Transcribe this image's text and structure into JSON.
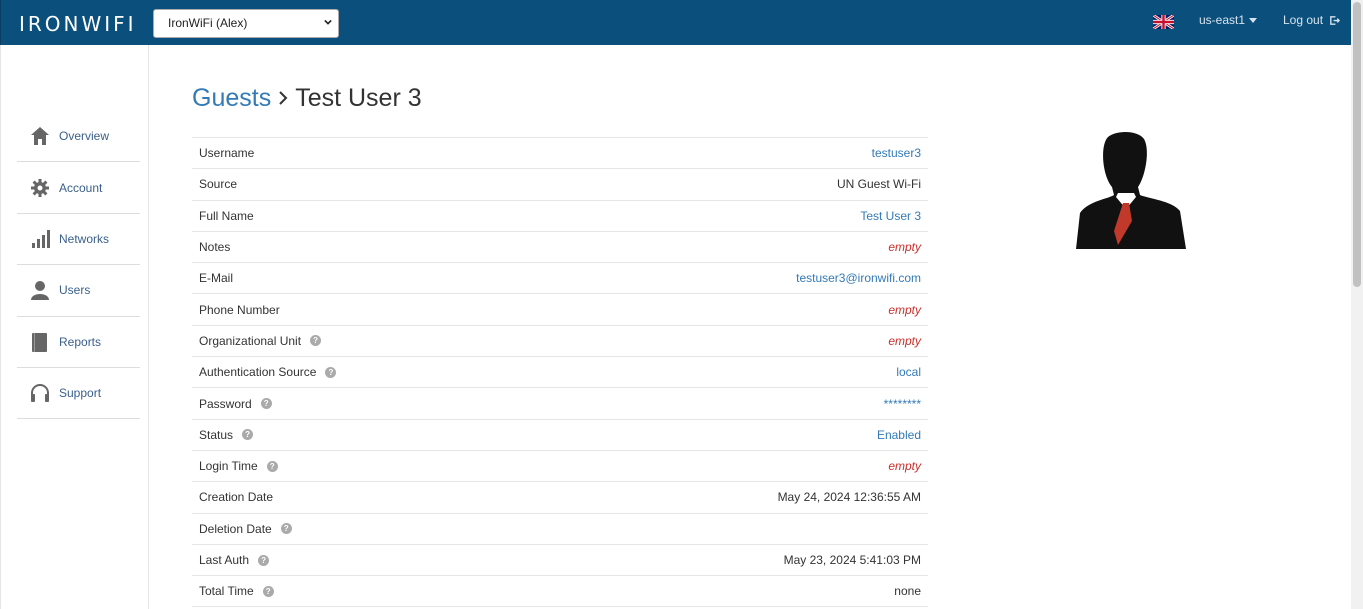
{
  "header": {
    "logo": "IRONWIFI",
    "account_select": "IronWiFi (Alex)",
    "region": "us-east1",
    "logout": "Log out",
    "flag_icon": "uk-flag-icon"
  },
  "sidebar": {
    "items": [
      {
        "label": "Overview",
        "icon": "home-icon"
      },
      {
        "label": "Account",
        "icon": "gear-icon"
      },
      {
        "label": "Networks",
        "icon": "signal-bars-icon"
      },
      {
        "label": "Users",
        "icon": "user-icon"
      },
      {
        "label": "Reports",
        "icon": "book-icon"
      },
      {
        "label": "Support",
        "icon": "headset-icon"
      }
    ]
  },
  "breadcrumb": {
    "parent": "Guests",
    "current": "Test User 3"
  },
  "properties": [
    {
      "label": "Username",
      "value": "testuser3",
      "style": "link",
      "help": false
    },
    {
      "label": "Source",
      "value": "UN Guest Wi-Fi",
      "style": "plain",
      "help": false
    },
    {
      "label": "Full Name",
      "value": "Test User 3",
      "style": "link",
      "help": false
    },
    {
      "label": "Notes",
      "value": "empty",
      "style": "empty",
      "help": false
    },
    {
      "label": "E-Mail",
      "value": "testuser3@ironwifi.com",
      "style": "link",
      "help": false
    },
    {
      "label": "Phone Number",
      "value": "empty",
      "style": "empty",
      "help": false
    },
    {
      "label": "Organizational Unit",
      "value": "empty",
      "style": "empty",
      "help": true
    },
    {
      "label": "Authentication Source",
      "value": "local",
      "style": "link",
      "help": true
    },
    {
      "label": "Password",
      "value": "********",
      "style": "link",
      "help": true
    },
    {
      "label": "Status",
      "value": "Enabled",
      "style": "link",
      "help": true
    },
    {
      "label": "Login Time",
      "value": "empty",
      "style": "empty",
      "help": true
    },
    {
      "label": "Creation Date",
      "value": "May 24, 2024 12:36:55 AM",
      "style": "plain",
      "help": false
    },
    {
      "label": "Deletion Date",
      "value": "",
      "style": "plain",
      "help": true
    },
    {
      "label": "Last Auth",
      "value": "May 23, 2024 5:41:03 PM",
      "style": "plain",
      "help": true
    },
    {
      "label": "Total Time",
      "value": "none",
      "style": "plain",
      "help": true
    }
  ],
  "colors": {
    "header_bg": "#0b4f7c",
    "link": "#337ab7",
    "empty": "#c9302c"
  }
}
